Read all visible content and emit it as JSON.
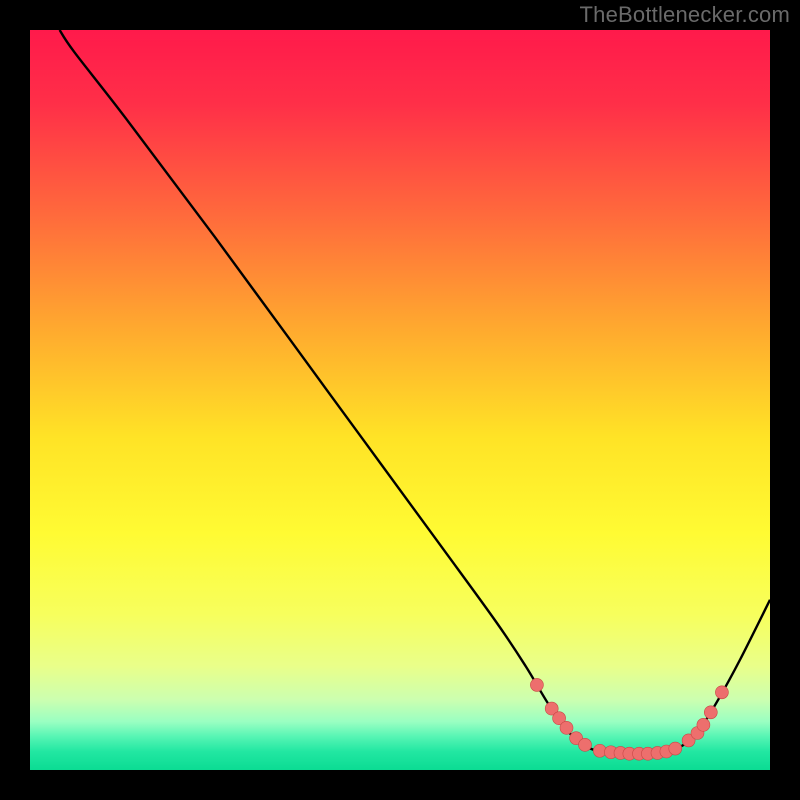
{
  "attribution": "TheBottlenecker.com",
  "colors": {
    "background": "#000000",
    "curve": "#000000",
    "marker_fill": "#ed6f6d",
    "marker_stroke": "#c94847",
    "gradient_stops": [
      {
        "offset": 0.0,
        "color": "#ff1a4b"
      },
      {
        "offset": 0.1,
        "color": "#ff2f48"
      },
      {
        "offset": 0.25,
        "color": "#ff6a3c"
      },
      {
        "offset": 0.4,
        "color": "#ffa82f"
      },
      {
        "offset": 0.55,
        "color": "#ffe326"
      },
      {
        "offset": 0.68,
        "color": "#fffb33"
      },
      {
        "offset": 0.79,
        "color": "#f7ff5d"
      },
      {
        "offset": 0.86,
        "color": "#e9ff8a"
      },
      {
        "offset": 0.905,
        "color": "#ccffb0"
      },
      {
        "offset": 0.935,
        "color": "#99ffc2"
      },
      {
        "offset": 0.955,
        "color": "#56f5b4"
      },
      {
        "offset": 0.975,
        "color": "#22e7a2"
      },
      {
        "offset": 1.0,
        "color": "#0bdc93"
      }
    ]
  },
  "chart_data": {
    "type": "line",
    "xlim": [
      0,
      100
    ],
    "ylim": [
      0,
      100
    ],
    "xlabel": "",
    "ylabel": "",
    "title": "",
    "curve": [
      {
        "x": 4,
        "y": 100
      },
      {
        "x": 6,
        "y": 97
      },
      {
        "x": 13,
        "y": 88
      },
      {
        "x": 25,
        "y": 72
      },
      {
        "x": 40,
        "y": 51.5
      },
      {
        "x": 55,
        "y": 31
      },
      {
        "x": 63,
        "y": 20
      },
      {
        "x": 67,
        "y": 14
      },
      {
        "x": 70,
        "y": 9
      },
      {
        "x": 72.5,
        "y": 5.5
      },
      {
        "x": 74.5,
        "y": 3.5
      },
      {
        "x": 77,
        "y": 2.5
      },
      {
        "x": 80,
        "y": 2.2
      },
      {
        "x": 83,
        "y": 2.2
      },
      {
        "x": 86,
        "y": 2.5
      },
      {
        "x": 88.5,
        "y": 3.5
      },
      {
        "x": 90.5,
        "y": 5.5
      },
      {
        "x": 93,
        "y": 9.5
      },
      {
        "x": 96,
        "y": 15
      },
      {
        "x": 100,
        "y": 23
      }
    ],
    "markers": [
      {
        "x": 68.5,
        "y": 11.5
      },
      {
        "x": 70.5,
        "y": 8.3
      },
      {
        "x": 71.5,
        "y": 7.0
      },
      {
        "x": 72.5,
        "y": 5.7
      },
      {
        "x": 73.8,
        "y": 4.3
      },
      {
        "x": 75.0,
        "y": 3.4
      },
      {
        "x": 77.0,
        "y": 2.6
      },
      {
        "x": 78.5,
        "y": 2.4
      },
      {
        "x": 79.8,
        "y": 2.3
      },
      {
        "x": 81.0,
        "y": 2.2
      },
      {
        "x": 82.3,
        "y": 2.2
      },
      {
        "x": 83.5,
        "y": 2.2
      },
      {
        "x": 84.8,
        "y": 2.3
      },
      {
        "x": 86.0,
        "y": 2.5
      },
      {
        "x": 87.2,
        "y": 2.9
      },
      {
        "x": 89.0,
        "y": 4.0
      },
      {
        "x": 90.2,
        "y": 5.0
      },
      {
        "x": 91.0,
        "y": 6.1
      },
      {
        "x": 92.0,
        "y": 7.8
      },
      {
        "x": 93.5,
        "y": 10.5
      }
    ]
  }
}
